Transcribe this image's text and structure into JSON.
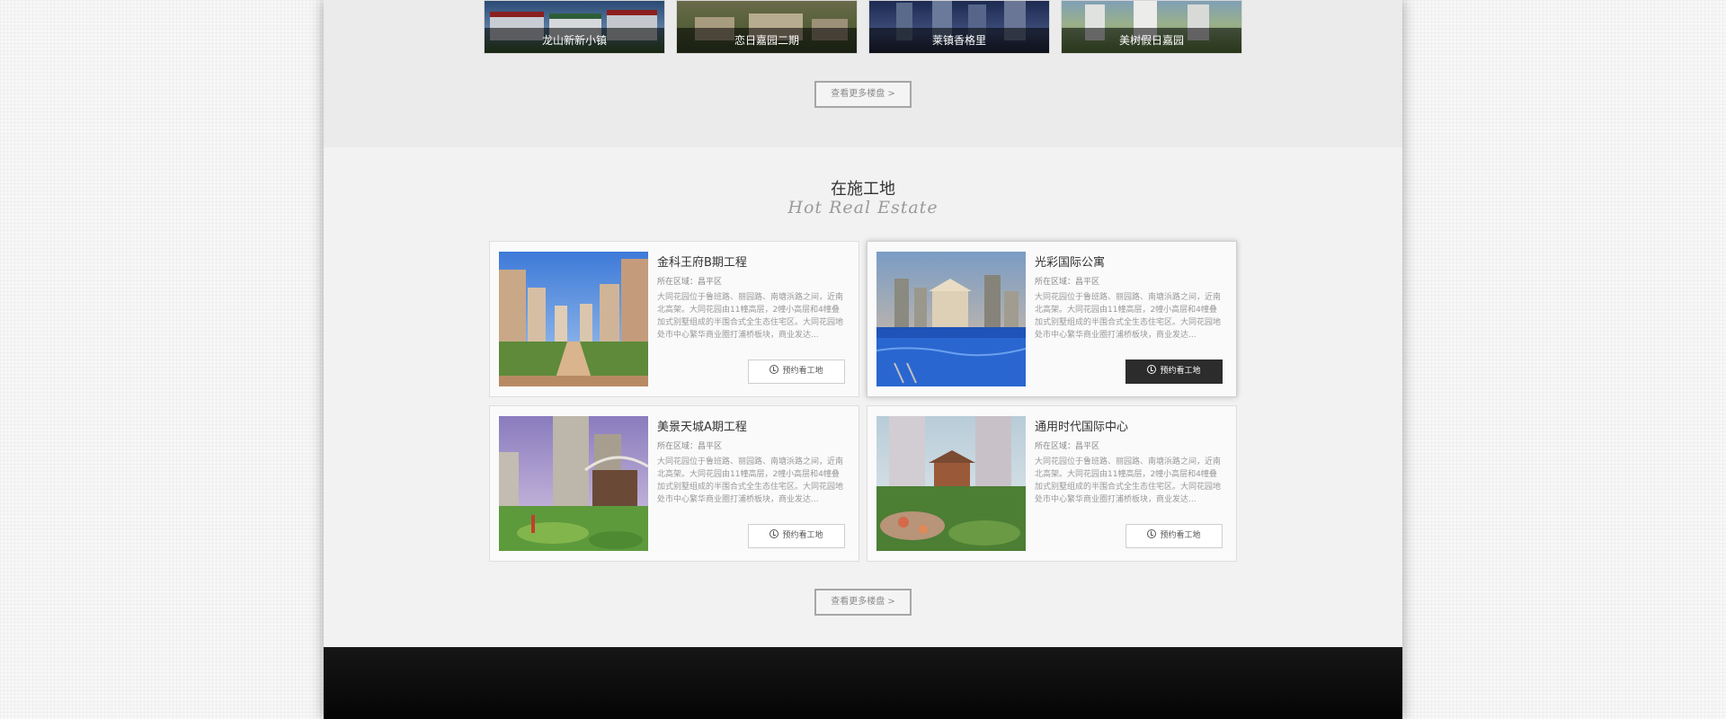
{
  "top_gallery": {
    "items": [
      {
        "caption": "龙山新新小镇"
      },
      {
        "caption": "恋日嘉园二期"
      },
      {
        "caption": "莱镇香格里"
      },
      {
        "caption": "美树假日嘉园"
      }
    ],
    "more_label": "查看更多楼盘 >"
  },
  "section": {
    "title": "在施工地",
    "subtitle": "Hot Real Estate",
    "more_label": "查看更多楼盘 >"
  },
  "cards": [
    {
      "title": "金科王府B期工程",
      "area": "所在区域：昌平区",
      "desc": "大同花园位于鲁班路、丽园路、南塘浜路之间，近南北高架。大同花园由11幢高层，2幢小高层和4幢叠加式别墅组成的半围合式全生态住宅区。大同花园地处市中心繁华商业圈打浦桥板块，商业发达...",
      "button": "预约看工地",
      "active": false
    },
    {
      "title": "光彩国际公寓",
      "area": "所在区域：昌平区",
      "desc": "大同花园位于鲁班路、丽园路、南塘浜路之间，近南北高架。大同花园由11幢高层，2幢小高层和4幢叠加式别墅组成的半围合式全生态住宅区。大同花园地处市中心繁华商业圈打浦桥板块，商业发达...",
      "button": "预约看工地",
      "active": true
    },
    {
      "title": "美景天城A期工程",
      "area": "所在区域：昌平区",
      "desc": "大同花园位于鲁班路、丽园路、南塘浜路之间，近南北高架。大同花园由11幢高层，2幢小高层和4幢叠加式别墅组成的半围合式全生态住宅区。大同花园地处市中心繁华商业圈打浦桥板块，商业发达...",
      "button": "预约看工地",
      "active": false
    },
    {
      "title": "通用时代国际中心",
      "area": "所在区域：昌平区",
      "desc": "大同花园位于鲁班路、丽园路、南塘浜路之间，近南北高架。大同花园由11幢高层，2幢小高层和4幢叠加式别墅组成的半围合式全生态住宅区。大同花园地处市中心繁华商业圈打浦桥板块，商业发达...",
      "button": "预约看工地",
      "active": false
    }
  ],
  "colors": {
    "accent_dark": "#2c2c2c",
    "footer": "#0c0c0c"
  }
}
